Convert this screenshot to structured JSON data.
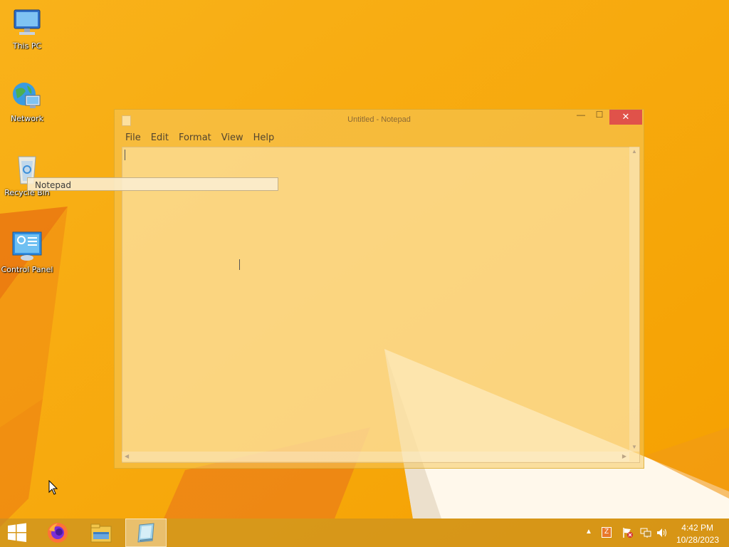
{
  "desktop": {
    "icons": [
      {
        "label": "This PC",
        "icon": "computer-icon"
      },
      {
        "label": "Network",
        "icon": "network-globe-icon"
      },
      {
        "label": "Recycle Bin",
        "icon": "recycle-bin-icon"
      },
      {
        "label": "Control Panel",
        "icon": "control-panel-icon"
      }
    ]
  },
  "drag_tooltip": {
    "label": "Notepad"
  },
  "notepad": {
    "title": "Untitled - Notepad",
    "close_glyph": "✕",
    "minimize_glyph": "—",
    "maximize_glyph": "☐",
    "menu": [
      "File",
      "Edit",
      "Format",
      "View",
      "Help"
    ],
    "content": ""
  },
  "taskbar": {
    "pinned": [
      "start-windows-icon",
      "firefox-icon",
      "file-explorer-icon",
      "notepad-icon"
    ],
    "tray_icons": [
      "show-hidden-icons-chevron",
      "app-tray-icon",
      "action-center-flag-icon",
      "network-icon",
      "volume-icon"
    ],
    "clock": {
      "time": "4:42 PM",
      "date": "10/28/2023"
    }
  },
  "colors": {
    "wallpaper": "#f7a70e",
    "close_button": "#e0524a",
    "taskbar": "#be8c28"
  }
}
